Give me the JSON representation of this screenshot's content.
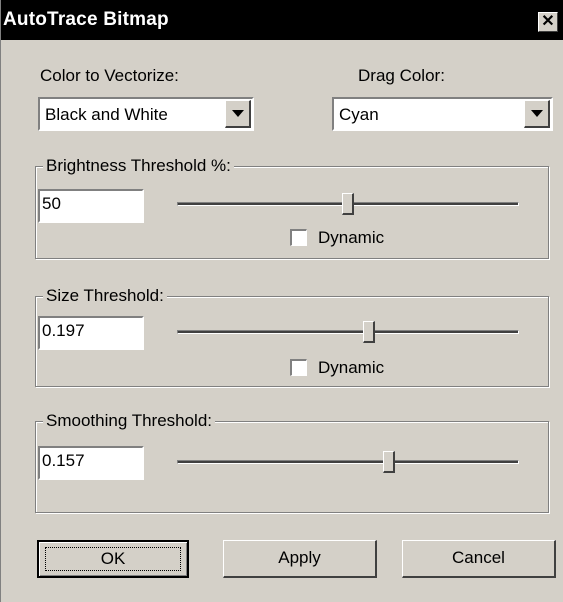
{
  "window": {
    "title": "AutoTrace Bitmap",
    "close_glyph": "✕"
  },
  "color_to_vectorize": {
    "label": "Color to Vectorize:",
    "value": "Black and White"
  },
  "drag_color": {
    "label": "Drag Color:",
    "value": "Cyan"
  },
  "brightness": {
    "legend": "Brightness Threshold %:",
    "value": "50",
    "slider_fraction": 0.5,
    "dynamic_label": "Dynamic",
    "dynamic_checked": false
  },
  "size": {
    "legend": "Size Threshold:",
    "value": "0.197",
    "slider_fraction": 0.56,
    "dynamic_label": "Dynamic",
    "dynamic_checked": false
  },
  "smoothing": {
    "legend": "Smoothing Threshold:",
    "value": "0.157",
    "slider_fraction": 0.62
  },
  "buttons": {
    "ok": "OK",
    "apply": "Apply",
    "cancel": "Cancel"
  },
  "colors": {
    "face": "#d4d0c8",
    "titlebar": "#000000",
    "title_text": "#ffffff"
  }
}
